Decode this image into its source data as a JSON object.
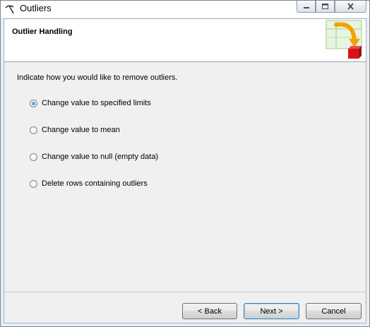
{
  "window": {
    "title": "Outliers",
    "icon": "pickaxe-icon",
    "controls": [
      "minimize-icon",
      "maximize-icon",
      "close-icon"
    ]
  },
  "header": {
    "title": "Outlier Handling",
    "graphic": "wizard-arrow-box-icon"
  },
  "main": {
    "instruction": "Indicate how you would like to remove outliers.",
    "options": [
      {
        "label": "Change value to specified limits",
        "selected": true
      },
      {
        "label": "Change value to mean",
        "selected": false
      },
      {
        "label": "Change value to null (empty data)",
        "selected": false
      },
      {
        "label": "Delete rows containing outliers",
        "selected": false
      }
    ]
  },
  "footer": {
    "back_label": "< Back",
    "next_label": "Next >",
    "cancel_label": "Cancel"
  },
  "colors": {
    "window_frame": "#e9eef5",
    "panel_bg": "#f0f0f0",
    "header_bg": "#ffffff",
    "accent": "#1c5fa8",
    "graphic_red": "#d8121a",
    "graphic_orange": "#f2a300"
  }
}
